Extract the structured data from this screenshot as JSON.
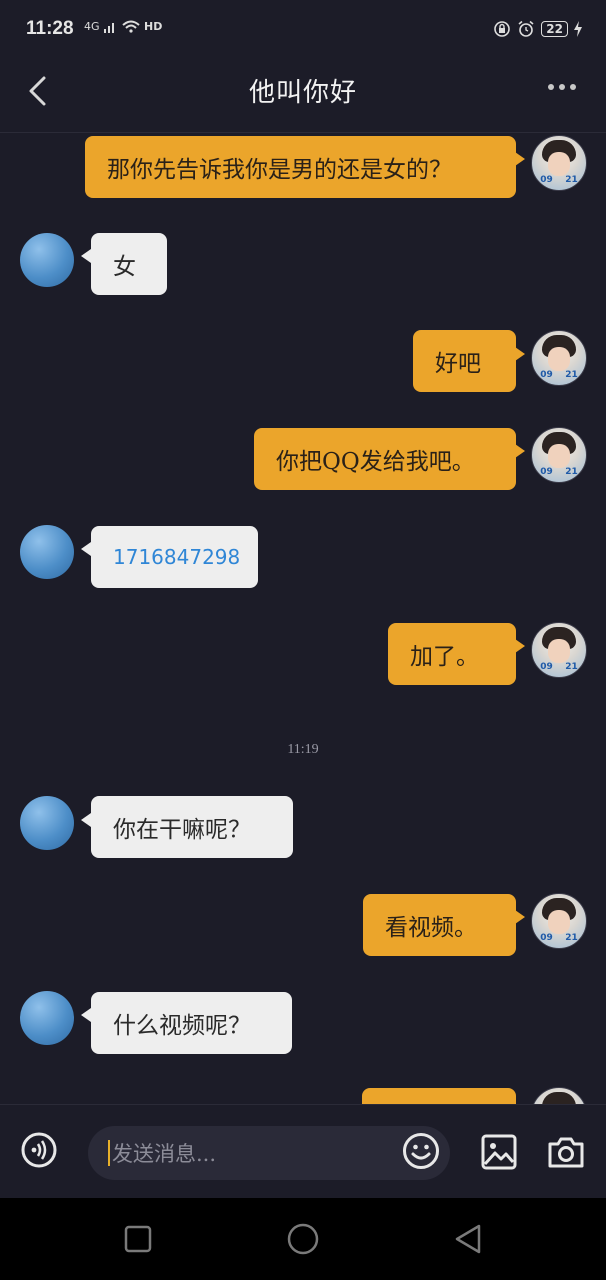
{
  "status": {
    "time": "11:28",
    "network": "4G",
    "hd": "HD",
    "battery": "22"
  },
  "header": {
    "title": "他叫你好"
  },
  "messages": [
    {
      "from": "me",
      "text": "那你先告诉我你是男的还是女的？"
    },
    {
      "from": "them",
      "text": "女"
    },
    {
      "from": "me",
      "text": "好吧"
    },
    {
      "from": "me",
      "text": "你把QQ发给我吧。"
    },
    {
      "from": "them",
      "text": "1716847298",
      "link": true
    },
    {
      "from": "me",
      "text": "加了。"
    },
    {
      "from": "system",
      "text": "11:19"
    },
    {
      "from": "them",
      "text": "你在干嘛呢？"
    },
    {
      "from": "me",
      "text": "看视频。"
    },
    {
      "from": "them",
      "text": "什么视频呢？"
    }
  ],
  "avatar_me": {
    "tag_left": "09",
    "tag_right": "21"
  },
  "input": {
    "placeholder": "发送消息..."
  },
  "colors": {
    "background": "#1c1c28",
    "my_bubble": "#eba52b",
    "their_bubble": "#eeeeee",
    "link": "#2f86d6"
  }
}
